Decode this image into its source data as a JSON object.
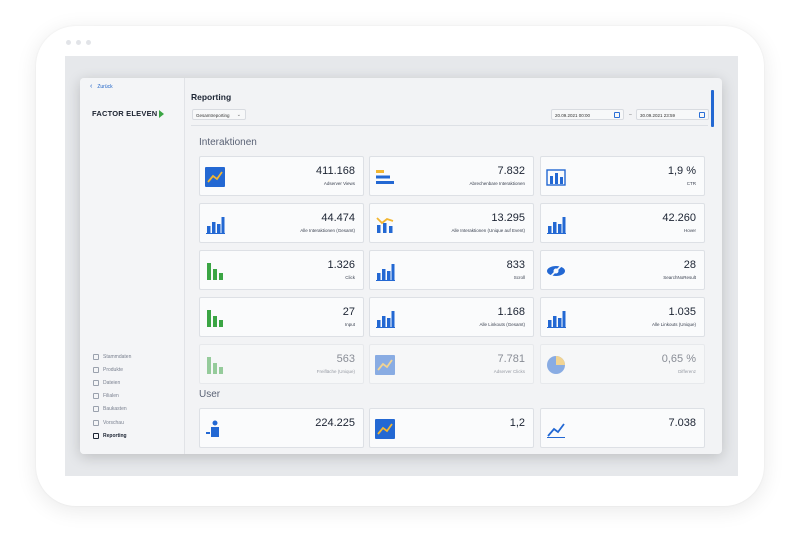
{
  "sidebar": {
    "back_label": "Zurück",
    "logo_text": "FACTOR ELEVEN",
    "nav": [
      "Stammdaten",
      "Produkte",
      "Dateien",
      "Filialen",
      "Baukasten",
      "Vorschau",
      "Reporting"
    ],
    "active": "Reporting"
  },
  "header": {
    "title": "Reporting",
    "report_select": "Gesamtreporting",
    "date_from": "20.09.2021 00:00",
    "date_to": "30.09.2021 23:59",
    "date_separator": "–"
  },
  "colors": {
    "accent": "#2368d3",
    "green": "#3aa544",
    "yellow": "#f2b631"
  },
  "sections": {
    "interaktionen": "Interaktionen",
    "user": "User"
  },
  "interaktionen_cards": [
    {
      "value": "411.168",
      "label": "Adserver Views",
      "icon": "line-chart-icon"
    },
    {
      "value": "7.832",
      "label": "Abrechenbare Interaktionen",
      "icon": "horizontal-bar-icon"
    },
    {
      "value": "1,9 %",
      "label": "CTR",
      "icon": "upload-chart-icon"
    },
    {
      "value": "44.474",
      "label": "Alle Interaktionen (Gesamt)",
      "icon": "bar-chart-icon"
    },
    {
      "value": "13.295",
      "label": "Alle Interaktionen (Unique auf Event)",
      "icon": "combo-chart-icon"
    },
    {
      "value": "42.260",
      "label": "Hover",
      "icon": "bar-chart-icon"
    },
    {
      "value": "1.326",
      "label": "Click",
      "icon": "green-bar-icon"
    },
    {
      "value": "833",
      "label": "Scroll",
      "icon": "bar-chart-icon"
    },
    {
      "value": "28",
      "label": "SearchNoResult",
      "icon": "eye-off-icon"
    },
    {
      "value": "27",
      "label": "Input",
      "icon": "green-bar-icon"
    },
    {
      "value": "1.168",
      "label": "Alle Linkouts (Gesamt)",
      "icon": "bar-chart-icon"
    },
    {
      "value": "1.035",
      "label": "Alle Linkouts (Unique)",
      "icon": "bar-chart-icon"
    },
    {
      "value": "563",
      "label": "Freifläche (Unique)",
      "icon": "green-bar-icon"
    },
    {
      "value": "7.781",
      "label": "Adserver Clicks",
      "icon": "line-chart-icon"
    },
    {
      "value": "0,65 %",
      "label": "Differenz",
      "icon": "pie-chart-icon"
    }
  ],
  "user_cards": [
    {
      "value": "224.225",
      "label": "",
      "icon": "user-icon"
    },
    {
      "value": "1,2",
      "label": "",
      "icon": "line-chart-icon"
    },
    {
      "value": "7.038",
      "label": "",
      "icon": "trend-icon"
    }
  ]
}
